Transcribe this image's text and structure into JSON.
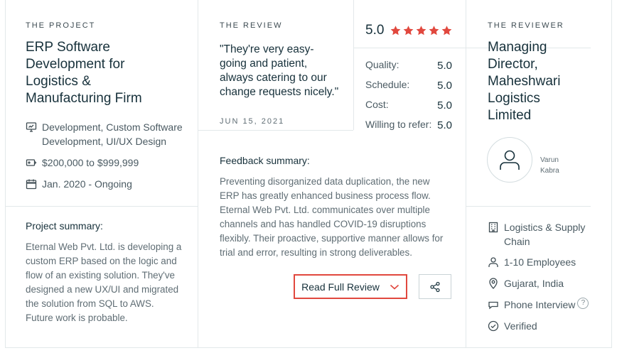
{
  "project": {
    "eyebrow": "THE PROJECT",
    "title_lines": [
      "ERP Software",
      "Development for",
      "Logistics &",
      "Manufacturing Firm"
    ],
    "service_line1": "Development, Custom Software",
    "service_line2": "Development, UI/UX Design",
    "budget": "$200,000 to $999,999",
    "timeline": "Jan. 2020 - Ongoing",
    "summary_heading": "Project summary:",
    "summary_lines": [
      "Eternal Web Pvt. Ltd. is developing a",
      "custom ERP based on the logic and",
      "flow of an existing solution. They've",
      "designed a new UX/UI and migrated",
      "the solution from SQL to AWS.",
      "Future work is probable."
    ]
  },
  "review": {
    "eyebrow": "THE REVIEW",
    "quote_lines": [
      "\"They're very easy-",
      "going and patient,",
      "always catering to our",
      "change requests nicely.\""
    ],
    "date": "JUN 15, 2021",
    "overall_score": "5.0",
    "star_color": "#e1483e",
    "star_count": 5,
    "ratings": [
      {
        "label": "Quality:",
        "value": "5.0"
      },
      {
        "label": "Schedule:",
        "value": "5.0"
      },
      {
        "label": "Cost:",
        "value": "5.0"
      },
      {
        "label": "Willing to refer:",
        "value": "5.0"
      }
    ],
    "feedback_heading": "Feedback summary:",
    "feedback_lines": [
      "Preventing disorganized data duplication, the new",
      "ERP has greatly enhanced business process flow.",
      "Eternal Web Pvt. Ltd. communicates over multiple",
      "channels and has handled COVID-19 disruptions",
      "flexibly. Their proactive, supportive manner allows for",
      "trial and error, resulting in strong deliverables."
    ],
    "read_full_label": "Read Full Review",
    "accent_color": "#e1483e"
  },
  "reviewer": {
    "eyebrow": "THE REVIEWER",
    "title_lines": [
      "Managing",
      "Director,",
      "Maheshwari",
      "Logistics",
      "Limited"
    ],
    "name_first": "Varun",
    "name_last": "Kabra",
    "industry_line1": "Logistics & Supply",
    "industry_line2": "Chain",
    "employees": "1-10 Employees",
    "location": "Gujarat, India",
    "interview": "Phone Interview",
    "interview_help": "?",
    "verified": "Verified"
  }
}
